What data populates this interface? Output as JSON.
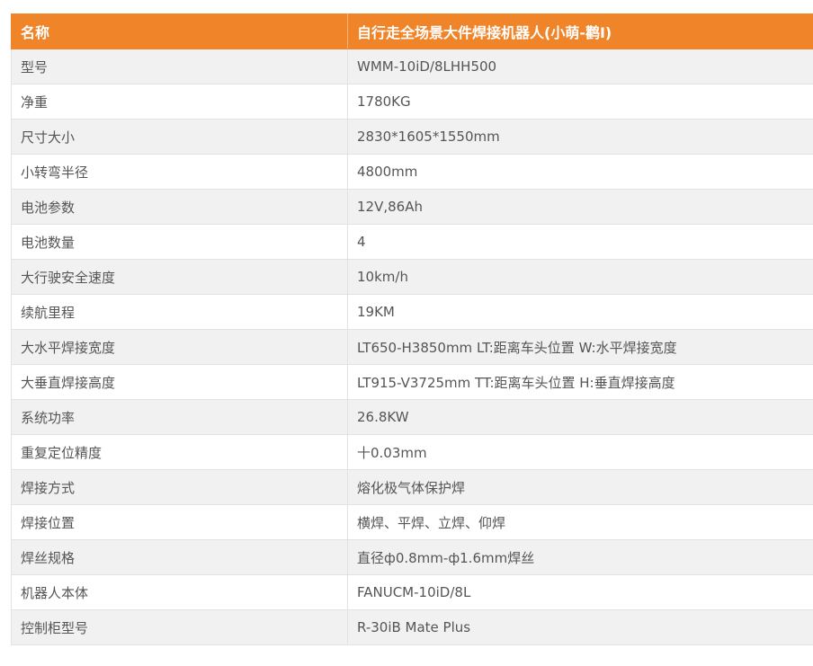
{
  "header": {
    "name_label": "名称",
    "product_name": "自行走全场景大件焊接机器人(小萌-鹳I)"
  },
  "specs": [
    {
      "label": "型号",
      "value": "WMM-10iD/8LHH500"
    },
    {
      "label": "净重",
      "value": "1780KG"
    },
    {
      "label": "尺寸大小",
      "value": "2830*1605*1550mm"
    },
    {
      "label": "小转弯半径",
      "value": "4800mm"
    },
    {
      "label": "电池参数",
      "value": "12V,86Ah"
    },
    {
      "label": "电池数量",
      "value": "4"
    },
    {
      "label": "大行驶安全速度",
      "value": "10km/h"
    },
    {
      "label": "续航里程",
      "value": "19KM"
    },
    {
      "label": "大水平焊接宽度",
      "value": "LT650-H3850mm LT:距离车头位置 W:水平焊接宽度"
    },
    {
      "label": "大垂直焊接高度",
      "value": "LT915-V3725mm TT:距离车头位置 H:垂直焊接高度"
    },
    {
      "label": "系统功率",
      "value": "26.8KW"
    },
    {
      "label": "重复定位精度",
      "value": "十0.03mm"
    },
    {
      "label": "焊接方式",
      "value": "熔化极气体保护焊"
    },
    {
      "label": "焊接位置",
      "value": "横焊、平焊、立焊、仰焊"
    },
    {
      "label": "焊丝规格",
      "value": "直径ф0.8mm-ф1.6mm焊丝"
    },
    {
      "label": "机器人本体",
      "value": "FANUCM-10iD/8L"
    },
    {
      "label": "控制柜型号",
      "value": "R-30iB Mate Plus"
    }
  ],
  "colors": {
    "header_bg": "#f08429",
    "row_alt_bg": "#f1f1f1",
    "text": "#555555"
  }
}
